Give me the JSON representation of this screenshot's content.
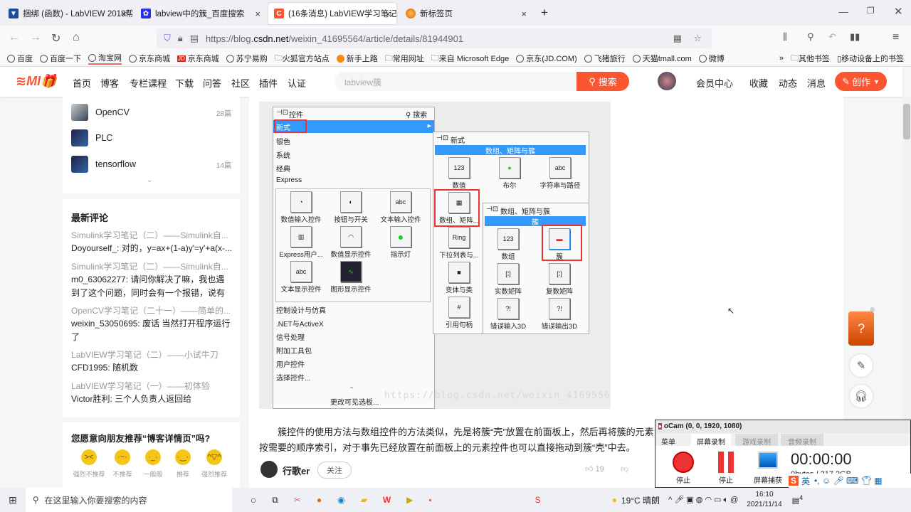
{
  "browser": {
    "tabs": [
      {
        "title": "捆绑 (函数) - LabVIEW 2018帮",
        "active": false
      },
      {
        "title": "labview中的簇_百度搜索",
        "active": false
      },
      {
        "title": "(16条消息) LabVIEW学习笔记",
        "active": true
      },
      {
        "title": "新标签页",
        "active": false
      }
    ],
    "new_tab": "+",
    "url_prefix": "https://blog.",
    "url_domain": "csdn.net",
    "url_path": "/weixin_41695564/article/details/81944901",
    "bookmarks": [
      "百度",
      "百度一下",
      "淘宝网",
      "京东商城",
      "京东商城",
      "苏宁易购",
      "火狐官方站点",
      "新手上路",
      "常用网址",
      "来自 Microsoft Edge",
      "京东(JD.COM)",
      "飞猪旅行",
      "天猫tmall.com",
      "微博"
    ],
    "more_bookmarks": "»",
    "other_bookmarks": "其他书签",
    "mobile_bookmarks": "移动设备上的书签",
    "ext_badge": "16"
  },
  "csdn": {
    "nav": [
      "首页",
      "博客",
      "专栏课程",
      "下载",
      "问答",
      "社区",
      "插件",
      "认证"
    ],
    "search_placeholder": "labview簇",
    "search_btn": "搜索",
    "user_nav": [
      "会员中心",
      "收藏",
      "动态",
      "消息"
    ],
    "create_btn": "创作"
  },
  "sidebar": {
    "columns": [
      {
        "name": "OpenCV",
        "count": "28篇"
      },
      {
        "name": "PLC",
        "count": ""
      },
      {
        "name": "tensorflow",
        "count": "14篇"
      }
    ],
    "comments_title": "最新评论",
    "comments": [
      {
        "article": "Simulink学习笔记（二）——Simulink自...",
        "text": "Doyourself_: 对的，y=ax+(1-a)y'=y'+a(x-..."
      },
      {
        "article": "Simulink学习笔记（二）——Simulink自...",
        "text": "m0_63062277: 请问你解决了嘛，我也遇到了这个问题，同时会有一个报错，说有重..."
      },
      {
        "article": "OpenCV学习笔记（二十一）——简单的...",
        "text": "weixin_53050695: 废话 当然打开程序运行了"
      },
      {
        "article": "LabVIEW学习笔记（二）——小试牛刀",
        "text": "CFD1995: 随机数"
      },
      {
        "article": "LabVIEW学习笔记（一）——初体验",
        "text": "Victor胜利: 三个人负责人返回给"
      }
    ],
    "survey_title": "您愿意向朋友推荐“博客详情页”吗?",
    "survey_options": [
      "强烈不推荐",
      "不推荐",
      "一般般",
      "推荐",
      "强烈推荐"
    ]
  },
  "palette": {
    "title": "控件",
    "search": "搜索",
    "items": [
      "新式",
      "银色",
      "系统",
      "经典",
      "Express"
    ],
    "icons": [
      "数值输入控件",
      "按钮与开关",
      "文本输入控件",
      "Express用户...",
      "数值显示控件",
      "指示灯",
      "文本显示控件",
      "图形显示控件"
    ],
    "items2": [
      "控制设计与仿真",
      ".NET与ActiveX",
      "信号处理",
      "附加工具包",
      "用户控件",
      "选择控件..."
    ],
    "change": "更改可见选板...",
    "sub1_title": "新式",
    "sub1_header": "数组、矩阵与簇",
    "sub1_icons": [
      "数值",
      "布尔",
      "字符串与路径",
      "数组、矩阵...",
      "下拉列表与...",
      "变体与类",
      "引用句柄"
    ],
    "sub2_title": "数组、矩阵与簇",
    "sub2_header": "簇",
    "sub2_icons": [
      "数组",
      "簇",
      "实数矩阵",
      "复数矩阵",
      "错误输入3D",
      "错误输出3D"
    ],
    "watermark": "https://blog.csdn.net/weixin_41695564"
  },
  "article": {
    "paragraph": "簇控件的使用方法与数组控件的方法类似，先是将簇“壳”放置在前面板上，然后再将簇的元素按需要的顺序索引，对于事先已经放置在前面板上的元素控件也可以直接拖动到簇“壳”中去。",
    "author": "行歌er",
    "follow": "关注",
    "likes": "19"
  },
  "ocam": {
    "title": "oCam (0, 0, 1920, 1080)",
    "tabs": [
      "菜单",
      "屏幕录制",
      "游戏录制",
      "音频录制"
    ],
    "buttons": [
      "停止",
      "停止",
      "屏幕捕获"
    ],
    "timer": "00:00:00",
    "size": "0bytes / 217.2GB"
  },
  "taskbar": {
    "search": "在这里输入你要搜索的内容",
    "weather": "19°C 晴朗",
    "time": "16:10",
    "date": "2021/11/14",
    "ime": "英",
    "notifications": "4"
  }
}
